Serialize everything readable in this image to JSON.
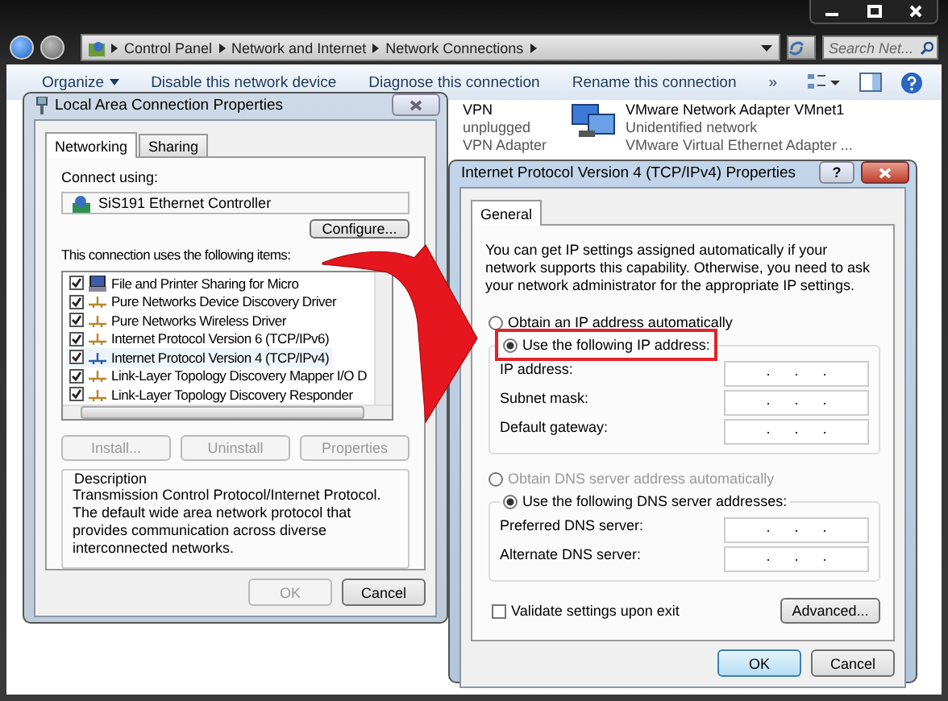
{
  "explorer": {
    "address_path": [
      "Control Panel",
      "Network and Internet",
      "Network Connections"
    ],
    "search": {
      "placeholder": "Search Net..."
    },
    "toolbar": [
      {
        "label": "Organize",
        "menu": true
      },
      {
        "label": "Disable this network device",
        "menu": false
      },
      {
        "label": "Diagnose this connection",
        "menu": false
      },
      {
        "label": "Rename this connection",
        "menu": false
      },
      {
        "label": "»",
        "menu": false
      }
    ],
    "connections": [
      {
        "name": "VPN",
        "status": "unplugged",
        "device": "VPN Adapter"
      },
      {
        "name": "VMware Network Adapter VMnet1",
        "status": "Unidentified network",
        "device": "VMware Virtual Ethernet Adapter ..."
      }
    ]
  },
  "lan_dialog": {
    "title": "Local Area Connection Properties",
    "tabs": [
      {
        "label": "Networking",
        "selected": true
      },
      {
        "label": "Sharing",
        "selected": false
      }
    ],
    "connect_label": "Connect using:",
    "adapter": "SiS191 Ethernet Controller",
    "configure": "Configure...",
    "items_label": "This connection uses the following items:",
    "items": [
      {
        "label": "File and Printer Sharing for Micro",
        "kind": "service",
        "checked": true,
        "selected": false
      },
      {
        "label": "Pure Networks Device Discovery Driver",
        "kind": "protocol",
        "checked": true,
        "selected": false
      },
      {
        "label": "Pure Networks Wireless Driver",
        "kind": "protocol",
        "checked": true,
        "selected": false
      },
      {
        "label": "Internet Protocol Version 6 (TCP/IPv6)",
        "kind": "protocol",
        "checked": true,
        "selected": false
      },
      {
        "label": "Internet Protocol Version 4 (TCP/IPv4)",
        "kind": "protocol",
        "checked": true,
        "selected": true
      },
      {
        "label": "Link-Layer Topology Discovery Mapper I/O D",
        "kind": "protocol",
        "checked": true,
        "selected": false
      },
      {
        "label": "Link-Layer Topology Discovery Responder",
        "kind": "protocol",
        "checked": true,
        "selected": false
      }
    ],
    "item_buttons": [
      {
        "label": "Install...",
        "disabled": true
      },
      {
        "label": "Uninstall",
        "disabled": true
      },
      {
        "label": "Properties",
        "disabled": true
      }
    ],
    "description_title": "Description",
    "description": "Transmission Control Protocol/Internet Protocol. The default wide area network protocol that provides communication across diverse interconnected networks.",
    "buttons": [
      {
        "label": "OK",
        "disabled": true
      },
      {
        "label": "Cancel",
        "disabled": false
      }
    ]
  },
  "ipv4_dialog": {
    "title": "Internet Protocol Version 4 (TCP/IPv4) Properties",
    "help": "?",
    "tabs": [
      {
        "label": "General",
        "selected": true
      }
    ],
    "intro": "You can get IP settings assigned automatically if your network supports this capability. Otherwise, you need to ask your network administrator for the appropriate IP settings.",
    "ip_options": [
      {
        "label": "Obtain an IP address automatically",
        "selected": false,
        "disabled": false,
        "highlighted": false
      },
      {
        "label": "Use the following IP address:",
        "selected": true,
        "disabled": false,
        "highlighted": true
      }
    ],
    "ip_fields": [
      {
        "label": "IP address:",
        "value": ".      .      ."
      },
      {
        "label": "Subnet mask:",
        "value": ".      .      ."
      },
      {
        "label": "Default gateway:",
        "value": ".      .      ."
      }
    ],
    "dns_options": [
      {
        "label": "Obtain DNS server address automatically",
        "selected": false,
        "disabled": true,
        "highlighted": false
      },
      {
        "label": "Use the following DNS server addresses:",
        "selected": true,
        "disabled": false,
        "highlighted": false
      }
    ],
    "dns_fields": [
      {
        "label": "Preferred DNS server:",
        "value": ".      .      ."
      },
      {
        "label": "Alternate DNS server:",
        "value": ".      .      ."
      }
    ],
    "validate": {
      "label": "Validate settings upon exit",
      "checked": false
    },
    "advanced": "Advanced...",
    "buttons": [
      {
        "label": "OK",
        "default": true
      },
      {
        "label": "Cancel",
        "default": false
      }
    ]
  }
}
